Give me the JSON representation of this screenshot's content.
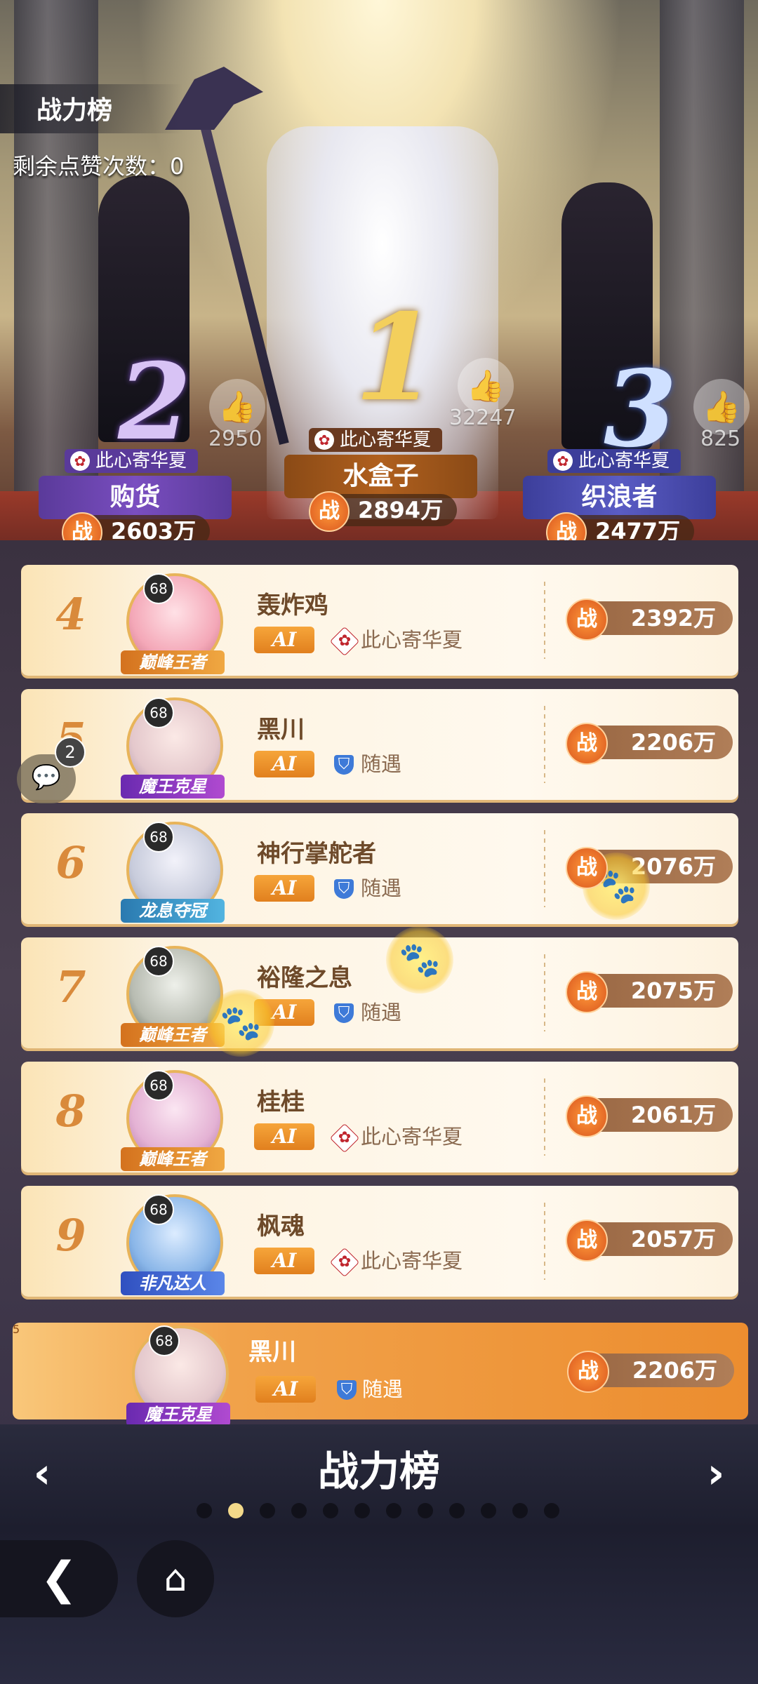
{
  "header": {
    "title": "战力榜",
    "likes_remaining": "剩余点赞次数：0"
  },
  "podium": [
    {
      "rank": "2",
      "guild": "此心寄华夏",
      "name": "购货",
      "power": "2603万",
      "likes": "2950",
      "plate_color": "#6a44b0"
    },
    {
      "rank": "1",
      "guild": "此心寄华夏",
      "name": "水盒子",
      "power": "2894万",
      "likes": "32247",
      "plate_color": "#a0561c"
    },
    {
      "rank": "3",
      "guild": "此心寄华夏",
      "name": "织浪者",
      "power": "2477万",
      "likes": "825",
      "plate_color": "#4a4cb0"
    }
  ],
  "power_label": "战",
  "rows": [
    {
      "rank": "4",
      "level": "68",
      "avatar_title": "巅峰王者",
      "name": "轰炸鸡",
      "tag": "AI",
      "guild_icon": "rose-icon",
      "guild": "此心寄华夏",
      "power": "2392万"
    },
    {
      "rank": "5",
      "level": "68",
      "avatar_title": "魔王克星",
      "name": "黑川",
      "tag": "AI",
      "guild_icon": "shield-icon",
      "guild": "随遇",
      "power": "2206万"
    },
    {
      "rank": "6",
      "level": "68",
      "avatar_title": "龙息夺冠",
      "name": "神行掌舵者",
      "tag": "AI",
      "guild_icon": "shield-icon",
      "guild": "随遇",
      "power": "2076万"
    },
    {
      "rank": "7",
      "level": "68",
      "avatar_title": "巅峰王者",
      "name": "裕隆之息",
      "tag": "AI",
      "guild_icon": "shield-icon",
      "guild": "随遇",
      "power": "2075万"
    },
    {
      "rank": "8",
      "level": "68",
      "avatar_title": "巅峰王者",
      "name": "桂桂",
      "tag": "AI",
      "guild_icon": "rose-icon",
      "guild": "此心寄华夏",
      "power": "2061万"
    },
    {
      "rank": "9",
      "level": "68",
      "avatar_title": "非凡达人",
      "name": "枫魂",
      "tag": "AI",
      "guild_icon": "rose-icon",
      "guild": "此心寄华夏",
      "power": "2057万"
    }
  ],
  "my_row": {
    "rank": "5",
    "level": "68",
    "avatar_title": "魔王克星",
    "name": "黑川",
    "tag": "AI",
    "guild": "随遇",
    "power": "2206万"
  },
  "chat_bubble": {
    "badge": "2"
  },
  "footer": {
    "title": "战力榜",
    "page_count": 12,
    "active_page": 2
  },
  "colors": {
    "accent": "#ec8d2f",
    "row_bg": "#fff9ee",
    "rank_number": "#d98a3b"
  }
}
